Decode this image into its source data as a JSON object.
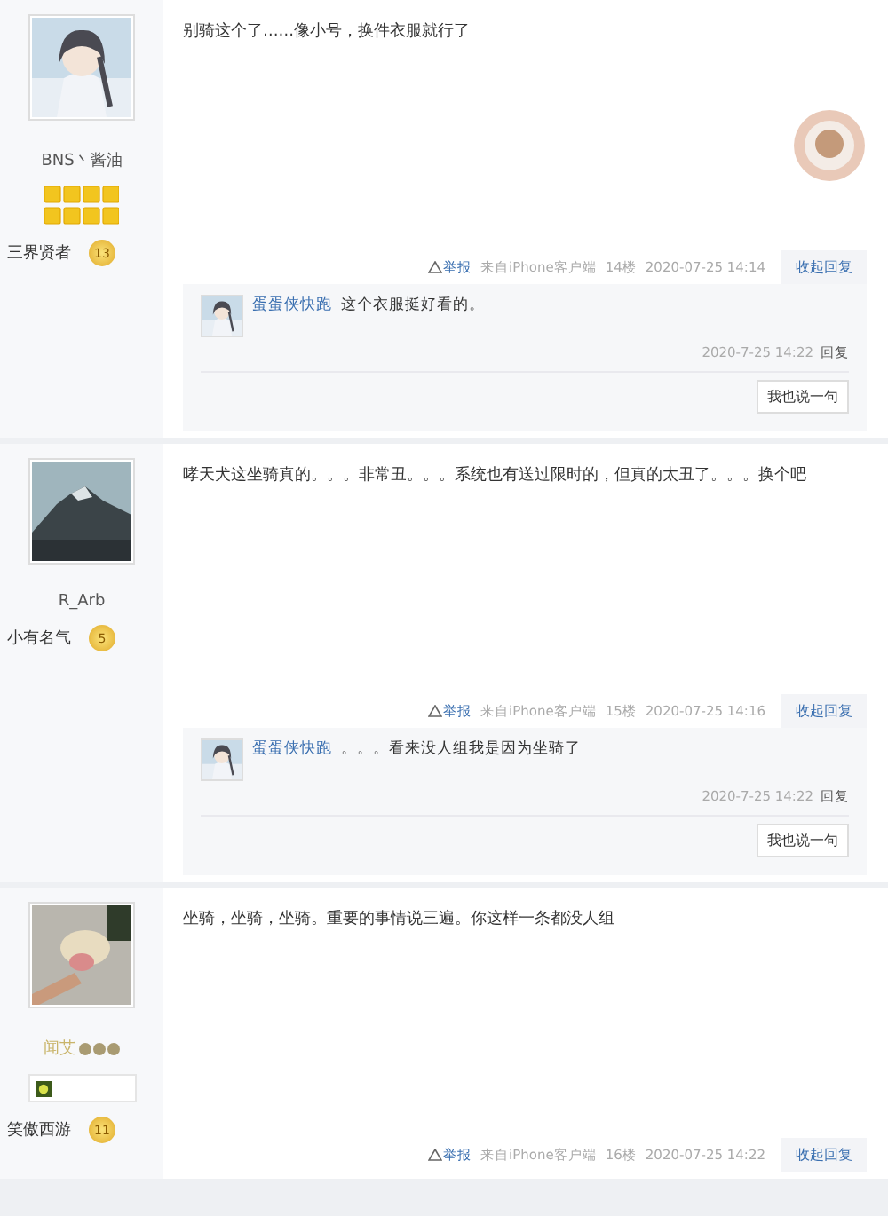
{
  "posts": [
    {
      "user": {
        "name": "BNS丶酱油",
        "name_icons": false,
        "medals": true,
        "badge_box": false,
        "level_title": "三界贤者",
        "level_badge": "13"
      },
      "content": "别骑这个了……像小号，换件衣服就行了",
      "sticker": true,
      "meta": {
        "report": "举报",
        "source": "来自iPhone客户端",
        "floor": "14楼",
        "time": "2020-07-25 14:14",
        "collapse": "收起回复"
      },
      "replies": [
        {
          "name": "蛋蛋侠快跑",
          "text": "这个衣服挺好看的。",
          "time": "2020-7-25 14:22",
          "reply": "回复"
        }
      ],
      "reply_button": "我也说一句"
    },
    {
      "user": {
        "name": "R_Arb",
        "name_icons": false,
        "medals": false,
        "badge_box": false,
        "level_title": "小有名气",
        "level_badge": "5"
      },
      "content": "哮天犬这坐骑真的。。。非常丑。。。系统也有送过限时的，但真的太丑了。。。换个吧",
      "sticker": false,
      "meta": {
        "report": "举报",
        "source": "来自iPhone客户端",
        "floor": "15楼",
        "time": "2020-07-25 14:16",
        "collapse": "收起回复"
      },
      "replies": [
        {
          "name": "蛋蛋侠快跑",
          "text": "。。。看来没人组我是因为坐骑了",
          "time": "2020-7-25 14:22",
          "reply": "回复"
        }
      ],
      "reply_button": "我也说一句"
    },
    {
      "user": {
        "name": "闻艾",
        "name_icons": true,
        "medals": false,
        "badge_box": true,
        "level_title": "笑傲西游",
        "level_badge": "11"
      },
      "content": "坐骑，坐骑，坐骑。重要的事情说三遍。你这样一条都没人组",
      "sticker": false,
      "meta": {
        "report": "举报",
        "source": "来自iPhone客户端",
        "floor": "16楼",
        "time": "2020-07-25 14:22",
        "collapse": "收起回复"
      }
    }
  ]
}
